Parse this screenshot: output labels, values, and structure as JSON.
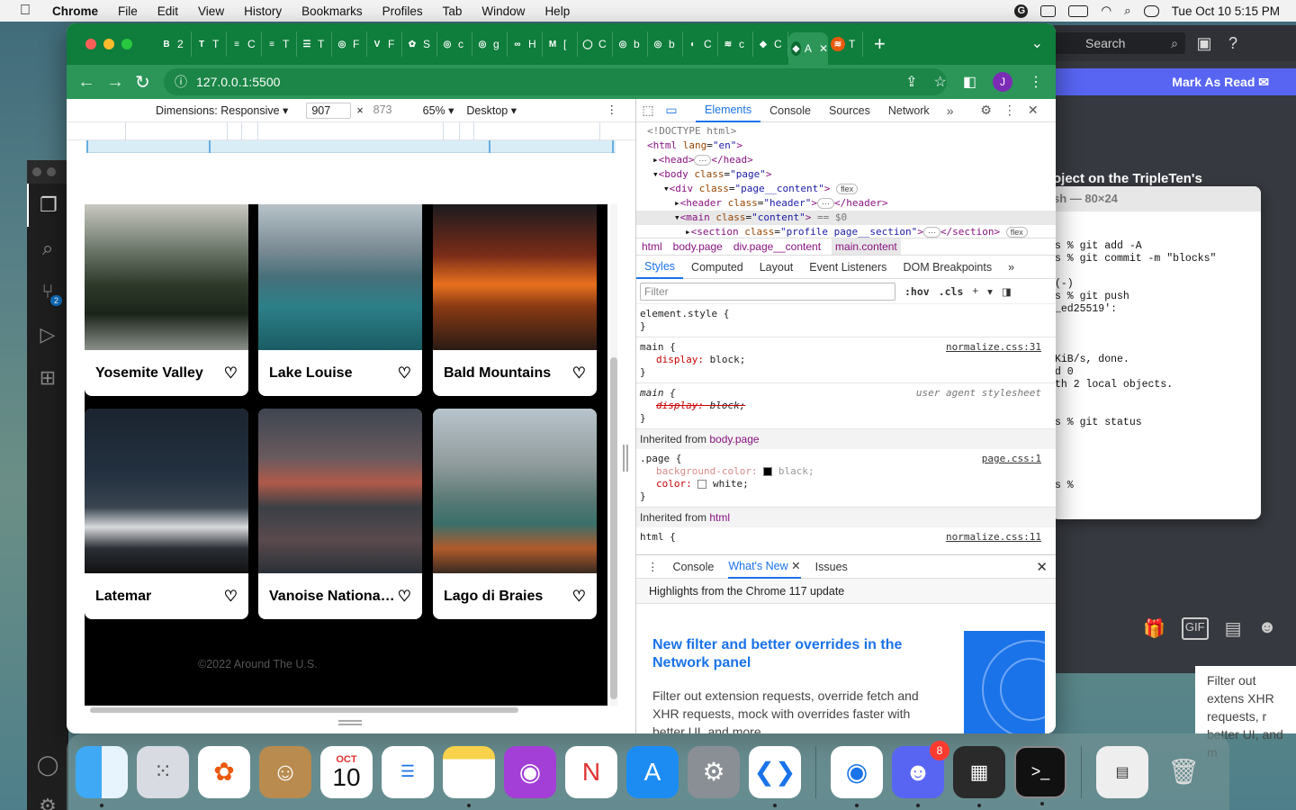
{
  "menubar": {
    "app": "Chrome",
    "items": [
      "File",
      "Edit",
      "View",
      "History",
      "Bookmarks",
      "Profiles",
      "Tab",
      "Window",
      "Help"
    ],
    "datetime": "Tue Oct 10  5:15 PM"
  },
  "browser": {
    "tabs": [
      {
        "icon": "B",
        "label": "2",
        "color": "#3b5bdb"
      },
      {
        "icon": "T",
        "label": "T",
        "color": "#1c7ed6"
      },
      {
        "icon": "≡",
        "label": "C",
        "color": "#3b5bdb"
      },
      {
        "icon": "≡",
        "label": "T",
        "color": "#3b5bdb"
      },
      {
        "icon": "☰",
        "label": "T",
        "color": "#333"
      },
      {
        "icon": "◎",
        "label": "F",
        "color": "#777"
      },
      {
        "icon": "V",
        "label": "F",
        "color": "#1971c2"
      },
      {
        "icon": "✿",
        "label": "S",
        "color": "#e64980"
      },
      {
        "icon": "◎",
        "label": "c",
        "color": "#777"
      },
      {
        "icon": "◎",
        "label": "g",
        "color": "#777"
      },
      {
        "icon": "∞",
        "label": "H",
        "color": "#2f9e44"
      },
      {
        "icon": "M",
        "label": "[",
        "color": "#c92a2a"
      },
      {
        "icon": "◯",
        "label": "C",
        "color": "#111"
      },
      {
        "icon": "◎",
        "label": "b",
        "color": "#777"
      },
      {
        "icon": "◎",
        "label": "b",
        "color": "#777"
      },
      {
        "icon": "◐",
        "label": "C",
        "color": "#222"
      },
      {
        "icon": "≋",
        "label": "c",
        "color": "#e8590c"
      },
      {
        "icon": "◆",
        "label": "C",
        "color": "#e03131"
      }
    ],
    "active_tab": {
      "label": "A"
    },
    "tab_after": {
      "icon": "≋",
      "label": "T",
      "color": "#e8590c"
    },
    "url": "127.0.0.1:5500",
    "profile_initial": "J"
  },
  "device_toolbar": {
    "dimensions_label": "Dimensions: Responsive",
    "width": "907",
    "height": "873",
    "zoom": "65%",
    "device": "Desktop"
  },
  "site": {
    "cards": [
      {
        "title": "Yosemite Valley",
        "img": "linear-gradient(180deg,#c9c9c2 0%,#6f7a6d 30%,#2f3a2b 55%,#1b2419 75%,#8a8f8a 100%)"
      },
      {
        "title": "Lake Louise",
        "img": "linear-gradient(180deg,#b6c2c8 0%,#7d8d96 30%,#47707a 50%,#2c7f88 70%,#1b5c64 100%)"
      },
      {
        "title": "Bald Mountains",
        "img": "linear-gradient(180deg,#1b1b1e 0%,#7a2c18 35%,#e8701e 55%,#8a3a14 70%,#2a1a14 100%)"
      },
      {
        "title": "Latemar",
        "img": "linear-gradient(180deg,#1b2430 0%,#233140 40%,#3a4450 60%,#d8dadc 72%,#2a2e34 85%,#111 100%)"
      },
      {
        "title": "Vanoise National Park",
        "img": "linear-gradient(180deg,#3e4550 0%,#6a5a5e 30%,#b05a4a 45%,#3a4046 60%,#5a4a4e 80%,#2a3036 100%)"
      },
      {
        "title": "Lago di Braies",
        "img": "linear-gradient(180deg,#b8c4cc 0%,#8e9a9a 35%,#5a7a76 55%,#3a6f6a 70%,#b05a2a 85%,#3a2a20 100%)"
      }
    ],
    "footer": "©2022 Around The U.S."
  },
  "devtools": {
    "tabs": [
      "Elements",
      "Console",
      "Sources",
      "Network"
    ],
    "dom": {
      "doctype": "<!DOCTYPE html>",
      "html_open": "<html",
      "lang_attr": "lang",
      "lang_val": "\"en\"",
      "head": "<head>",
      "head_close": "</head>",
      "body": "<body",
      "class_attr": "class",
      "body_class": "\"page\"",
      "div": "<div",
      "div_class": "\"page__content\"",
      "header": "<header",
      "header_class": "\"header\"",
      "header_close": "</header>",
      "main": "<main",
      "main_class": "\"content\"",
      "eq0": "== $0",
      "section": "<section",
      "section_class": "\"profile page__section\"",
      "section_close": "</section>",
      "flex": "flex",
      "ellipsis": "···"
    },
    "breadcrumbs": [
      "html",
      "body.page",
      "div.page__content",
      "main.content"
    ],
    "style_tabs": [
      "Styles",
      "Computed",
      "Layout",
      "Event Listeners",
      "DOM Breakpoints"
    ],
    "filter_placeholder": "Filter",
    "hov": ":hov",
    "cls": ".cls",
    "rules": {
      "element_style": "element.style {",
      "close": "}",
      "main_sel": "main {",
      "display": "display",
      "block": "block;",
      "normalize31": "normalize.css:31",
      "ua": "user agent stylesheet",
      "inherited_from": "Inherited from ",
      "body_page": "body.page",
      "page_sel": ".page {",
      "bgc": "background-color",
      "black": "black;",
      "color": "color",
      "white": "white;",
      "pagecss": "page.css:1",
      "html_tag": "html",
      "html_sel": "html {",
      "normalize11": "normalize.css:11"
    },
    "drawer": {
      "tabs": [
        "Console",
        "What's New",
        "Issues"
      ],
      "highlights": "Highlights from the Chrome 117 update",
      "news_title": "New filter and better overrides in the Network panel",
      "news_body": "Filter out extension requests, override fetch and XHR requests, mock with overrides faster with better UI, and more."
    }
  },
  "discord": {
    "search": "Search",
    "mark_read": "Mark As Read",
    "title": "oject on the TripleTen's"
  },
  "terminal": {
    "title": "sh — 80×24",
    "lines": "\n\ns % git add -A\ns % git commit -m \"blocks\"\n\n(-)\ns % git push\n_ed25519':\n\n\n\nKiB/s, done.\nd 0\nth 2 local objects.\n\n\ns % git status\n\n\n\n\ns % "
  },
  "bg_text": "Filter out extens XHR requests, r better UI, and m",
  "dock": {
    "calendar_month": "OCT",
    "calendar_day": "10",
    "discord_badge": "8"
  }
}
